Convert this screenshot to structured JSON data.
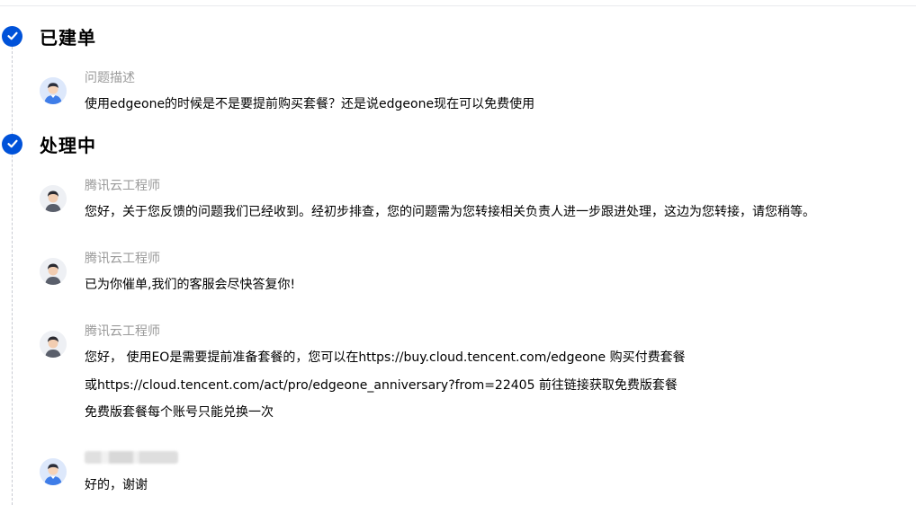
{
  "stages": [
    {
      "title": "已建单"
    },
    {
      "title": "处理中"
    }
  ],
  "messages": [
    {
      "author": "问题描述",
      "lines": [
        "使用edgeone的时候是不是要提前购买套餐？还是说edgeone现在可以免费使用"
      ]
    },
    {
      "author": "腾讯云工程师",
      "lines": [
        "您好，关于您反馈的问题我们已经收到。经初步排查，您的问题需为您转接相关负责人进一步跟进处理，这边为您转接，请您稍等。"
      ]
    },
    {
      "author": "腾讯云工程师",
      "lines": [
        "已为你催单,我们的客服会尽快答复你!"
      ]
    },
    {
      "author": "腾讯云工程师",
      "lines": [
        "您好， 使用EO是需要提前准备套餐的，您可以在https://buy.cloud.tencent.com/edgeone 购买付费套餐",
        "或https://cloud.tencent.com/act/pro/edgeone_anniversary?from=22405 前往链接获取免费版套餐",
        "免费版套餐每个账号只能兑换一次"
      ]
    },
    {
      "author": "",
      "lines": [
        "好的，谢谢"
      ]
    }
  ],
  "colors": {
    "accent": "#0052d9",
    "author": "#9a9a9a",
    "timeline": "#c8cbd2"
  },
  "icons": {
    "stage_marker": "check-icon",
    "user_avatar": "user-avatar",
    "engineer_avatar": "engineer-avatar"
  }
}
